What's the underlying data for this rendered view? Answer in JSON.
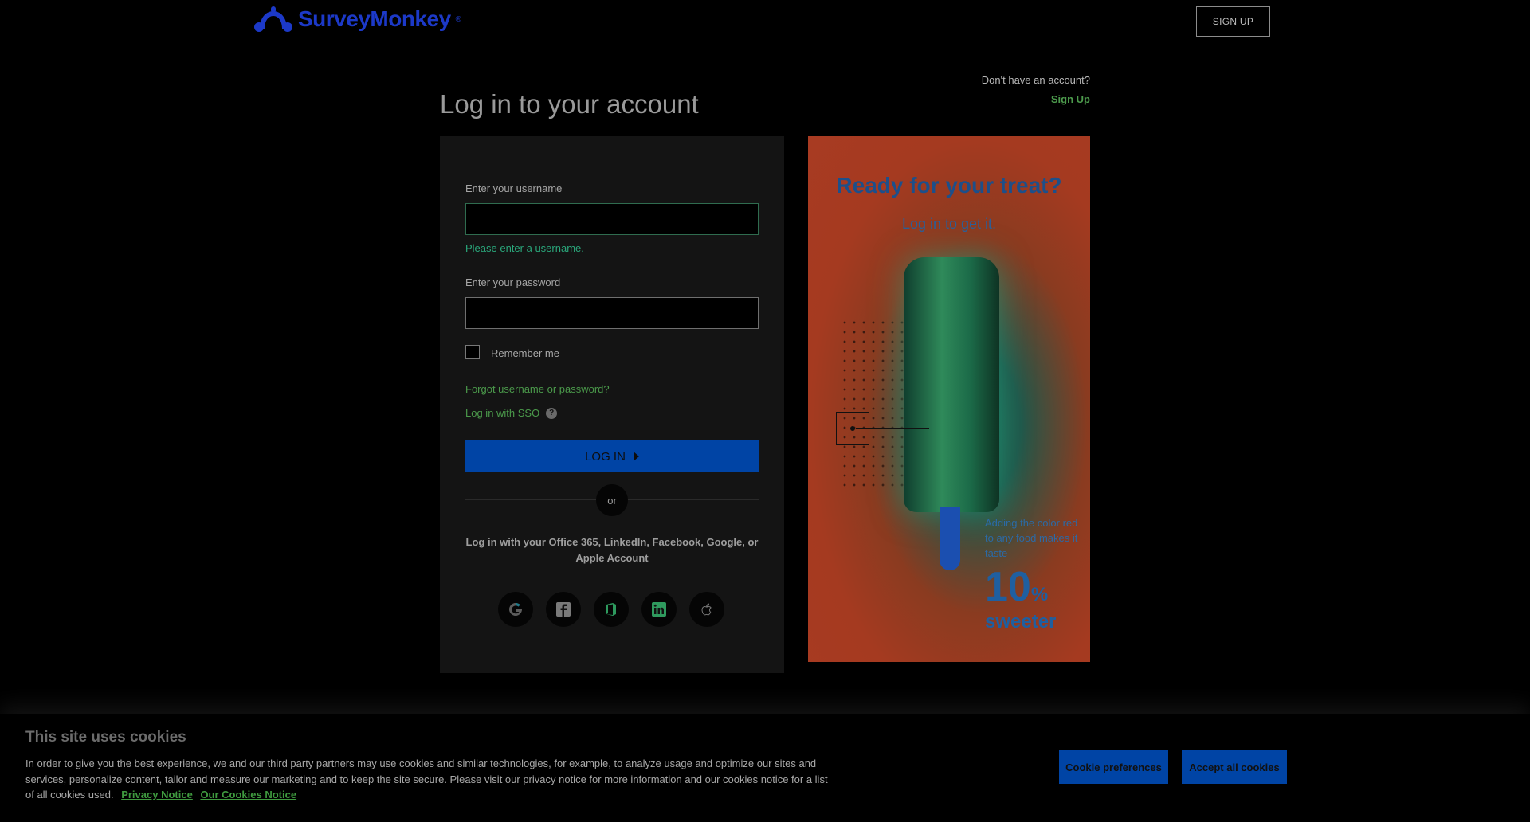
{
  "header": {
    "logo_text": "SurveyMonkey",
    "logo_reg": "®",
    "signup_button": "SIGN UP"
  },
  "main": {
    "title": "Log in to your account",
    "no_account_text": "Don't have an account?",
    "signup_link": "Sign Up"
  },
  "login_form": {
    "username_label": "Enter your username",
    "username_value": "",
    "username_error": "Please enter a username.",
    "password_label": "Enter your password",
    "password_value": "",
    "remember_label": "Remember me",
    "forgot_link": "Forgot username or password?",
    "sso_link": "Log in with SSO",
    "sso_help": "?",
    "login_button": "LOG IN",
    "or_text": "or",
    "social_text": "Log in with your Office 365, LinkedIn, Facebook, Google, or Apple Account",
    "social_icons": [
      "google-icon",
      "facebook-icon",
      "office365-icon",
      "linkedin-icon",
      "apple-icon"
    ]
  },
  "promo": {
    "title": "Ready for your treat?",
    "subtitle": "Log in to get it.",
    "note": "Adding the color red to any food makes it taste",
    "stat_value": "10",
    "stat_unit": "%",
    "stat_label": "sweeter"
  },
  "cookie_banner": {
    "title": "This site uses cookies",
    "text": "In order to give you the best experience, we and our third party partners may use cookies and similar technologies, for example, to analyze usage and optimize our sites and services, personalize content, tailor and measure our marketing and to keep the site secure. Please visit our privacy notice for more information and our cookies notice for a list of all cookies used.",
    "privacy_link": "Privacy Notice",
    "cookies_link": "Our Cookies Notice",
    "preferences_button": "Cookie preferences",
    "accept_button": "Accept all cookies"
  },
  "colors": {
    "brand_blue": "#0044a5",
    "link_green": "#4b9a4b",
    "error_green": "#2aa77b"
  }
}
